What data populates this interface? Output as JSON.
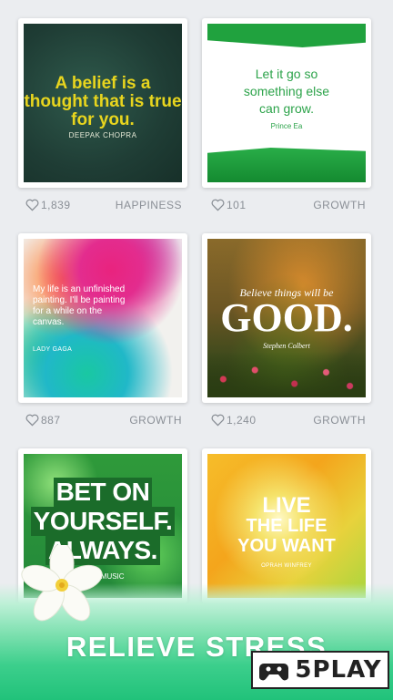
{
  "cards": [
    {
      "quote": "A belief is a thought that is true for you.",
      "author": "DEEPAK CHOPRA",
      "likes": "1,839",
      "category": "HAPPINESS"
    },
    {
      "quote": "Let it go so something else can grow.",
      "author": "Prince Ea",
      "likes": "101",
      "category": "GROWTH"
    },
    {
      "quote": "My life is an unfinished painting. I'll be painting for a while on the canvas.",
      "author": "LADY GAGA",
      "likes": "887",
      "category": "GROWTH"
    },
    {
      "quote_line1": "Believe things will be",
      "quote_line2": "GOOD.",
      "author": "Stephen Colbert",
      "likes": "1,240",
      "category": "GROWTH"
    },
    {
      "quote_line1": "BET ON",
      "quote_line2": "YOURSELF.",
      "quote_line3": "ALWAYS.",
      "author": "ERIN MUSIC"
    },
    {
      "quote_line1": "LIVE",
      "quote_line2": "THE LIFE",
      "quote_line3": "YOU WANT",
      "author": "OPRAH WINFREY"
    }
  ],
  "banner": {
    "text": "RELIEVE STRESS"
  },
  "watermark": {
    "text": "5PLAY"
  }
}
